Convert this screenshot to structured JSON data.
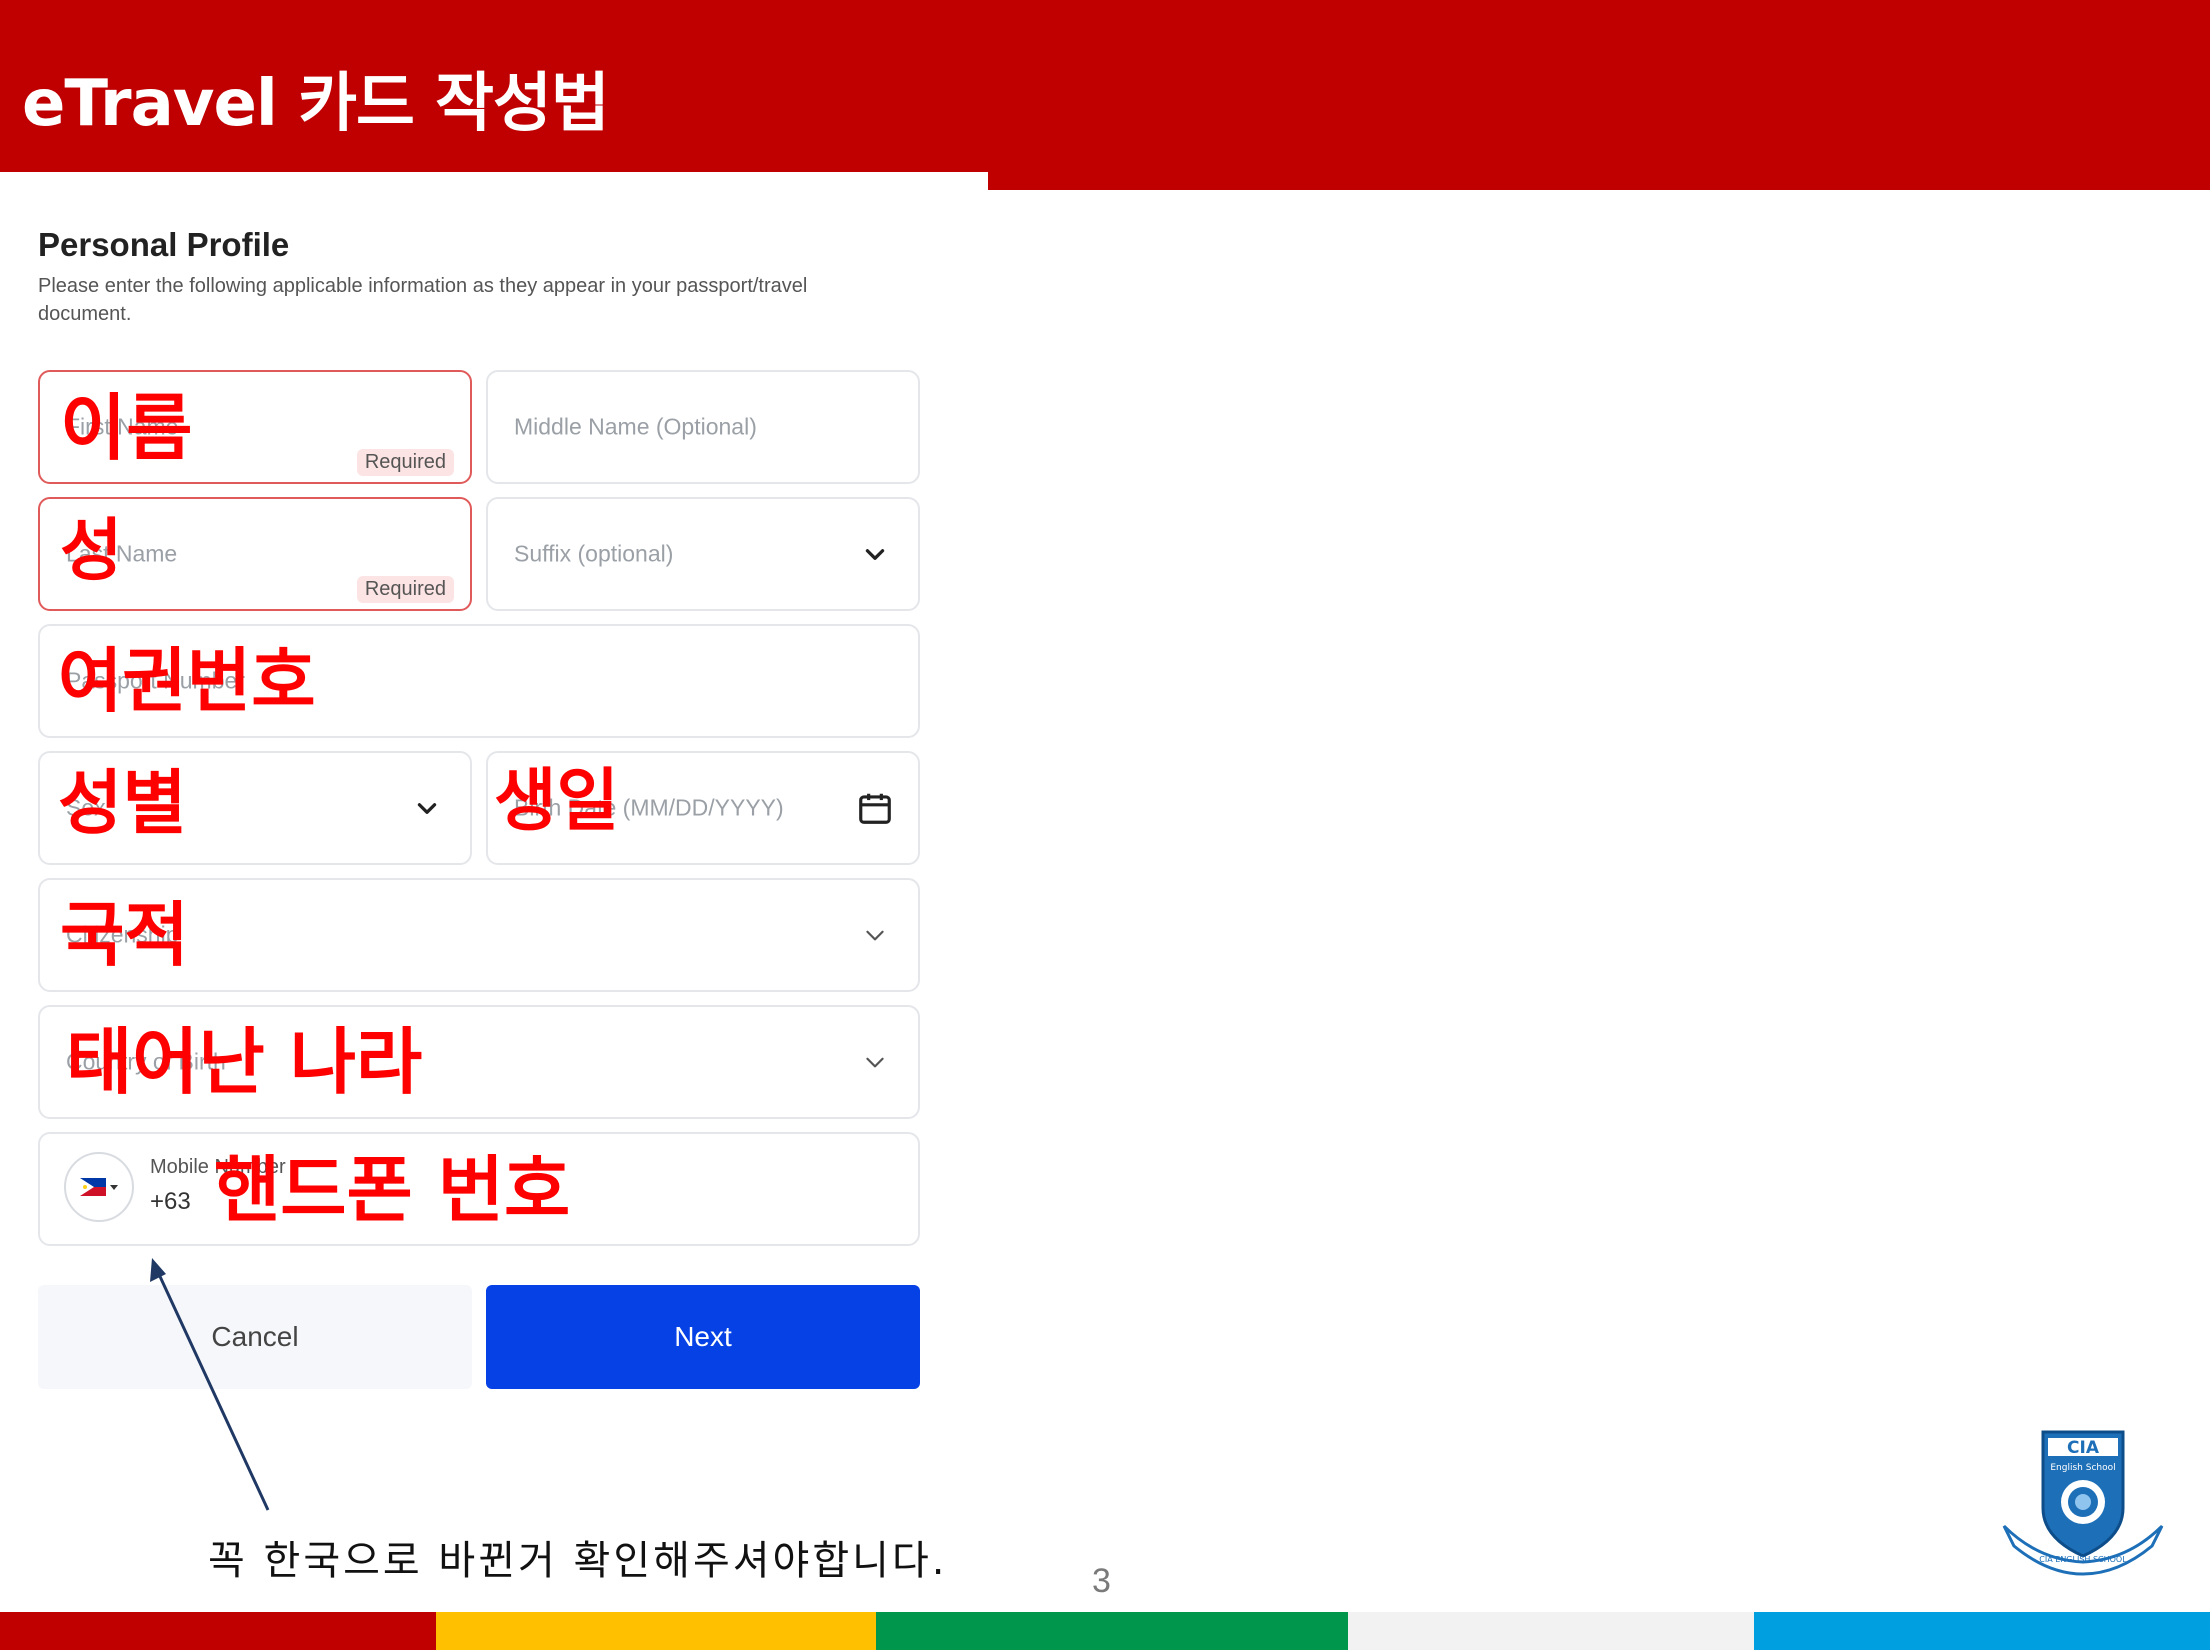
{
  "slide": {
    "title": "eTravel 카드 작성법",
    "page_number": "3"
  },
  "form": {
    "title": "Personal Profile",
    "description": "Please enter the following applicable information as they appear in your passport/travel document.",
    "fields": {
      "first_name": {
        "placeholder": "First Name",
        "badge": "Required"
      },
      "middle_name": {
        "placeholder": "Middle Name (Optional)"
      },
      "last_name": {
        "placeholder": "Last Name",
        "badge": "Required"
      },
      "suffix": {
        "placeholder": "Suffix (optional)"
      },
      "passport": {
        "placeholder": "Passport Number"
      },
      "sex": {
        "placeholder": "Sex"
      },
      "birth_date": {
        "placeholder": "Birth Date (MM/DD/YYYY)"
      },
      "citizenship": {
        "placeholder": "Citizenship"
      },
      "country_of_birth": {
        "placeholder": "Country of Birth"
      },
      "mobile": {
        "label": "Mobile Number",
        "code": "+63"
      }
    },
    "buttons": {
      "cancel": "Cancel",
      "next": "Next"
    }
  },
  "annotations": {
    "first_name": "이름",
    "last_name": "성",
    "passport": "여권번호",
    "sex": "성별",
    "birth_date": "생일",
    "citizenship": "국적",
    "country_of_birth": "태어난 나라",
    "mobile": "핸드폰 번호",
    "note": "꼭 한국으로 바뀐거 확인해주셔야합니다."
  },
  "logo": {
    "text": "CIA",
    "subtitle": "English School",
    "ribbon": "CIA ENGLISH SCHOOL"
  },
  "colors": {
    "header_red": "#c00000",
    "annotation_red": "#ff0000",
    "next_blue": "#0641e6",
    "stripes": [
      "#c00000",
      "#ffc000",
      "#00964b",
      "#f2f2f2",
      "#00a0e0"
    ]
  },
  "icons": {
    "dropdown": "chevron-down-icon",
    "calendar": "calendar-icon",
    "flag": "philippines-flag-icon",
    "arrow": "annotation-arrow"
  }
}
